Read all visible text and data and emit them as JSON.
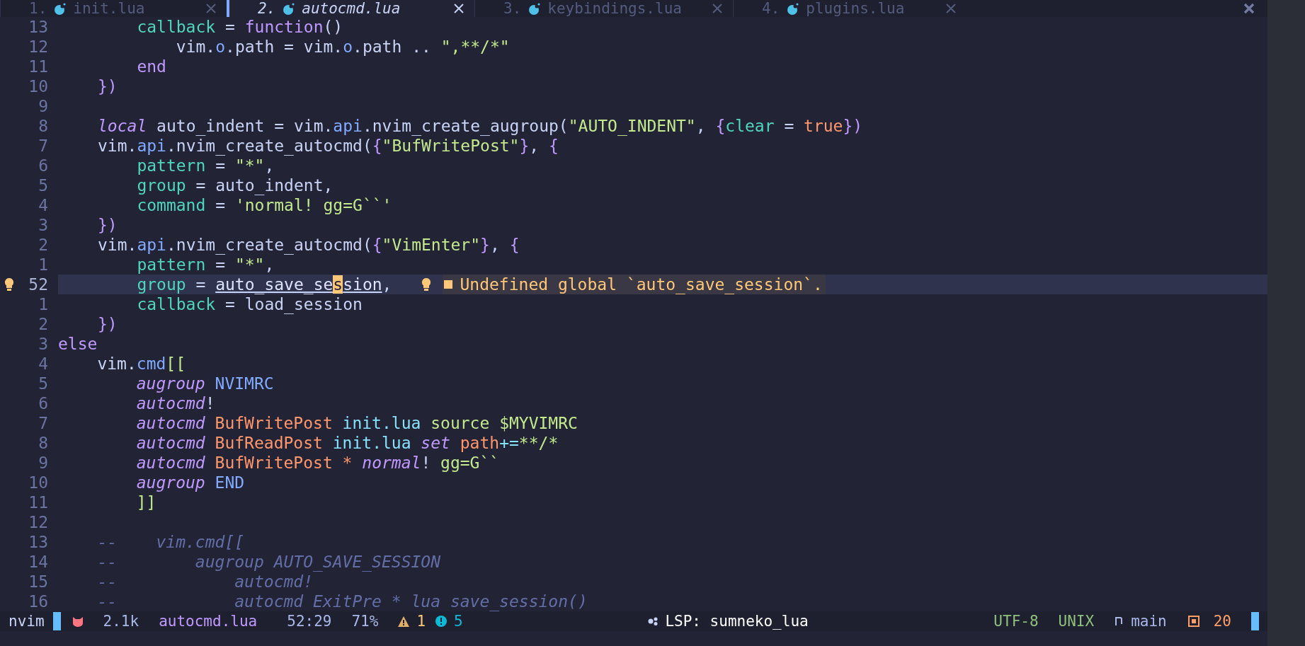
{
  "tabs": [
    {
      "index": "1.",
      "name": "init.lua",
      "selected": false
    },
    {
      "index": "2.",
      "name": "autocmd.lua",
      "selected": true
    },
    {
      "index": "3.",
      "name": "keybindings.lua",
      "selected": false
    },
    {
      "index": "4.",
      "name": "plugins.lua",
      "selected": false
    }
  ],
  "lines": [
    {
      "number": "13",
      "current": false,
      "segments": [
        {
          "text": "    callback",
          "kind": "field"
        },
        {
          "text": " = ",
          "kind": "plain"
        },
        {
          "text": "function",
          "kind": "keyword"
        },
        {
          "text": "()",
          "kind": "plain"
        }
      ]
    },
    {
      "number": "12",
      "current": false,
      "segments": [
        {
          "text": "        vim.",
          "kind": "plain"
        },
        {
          "text": "o",
          "kind": "prop"
        },
        {
          "text": ".path = vim.",
          "kind": "plain"
        },
        {
          "text": "o",
          "kind": "prop"
        },
        {
          "text": ".path .. ",
          "kind": "plain"
        },
        {
          "text": "\",**/*\"",
          "kind": "string"
        }
      ]
    },
    {
      "number": "11",
      "current": false,
      "segments": [
        {
          "text": "    end",
          "kind": "keyword"
        }
      ]
    },
    {
      "number": "10",
      "current": false,
      "segments": [
        {
          "text": "})",
          "kind": "keyword"
        }
      ]
    },
    {
      "number": "9",
      "current": false
    },
    {
      "number": "8",
      "current": false,
      "segments": [
        {
          "text": "local",
          "kind": "keyword-italic"
        },
        {
          "text": " auto_indent = vim.",
          "kind": "plain"
        },
        {
          "text": "api",
          "kind": "prop"
        },
        {
          "text": ".nvim_create_augroup(",
          "kind": "plain"
        },
        {
          "text": "\"AUTO_INDENT\"",
          "kind": "string"
        },
        {
          "text": ", ",
          "kind": "plain"
        },
        {
          "text": "{",
          "kind": "keyword"
        },
        {
          "text": "clear",
          "kind": "field"
        },
        {
          "text": " = ",
          "kind": "plain"
        },
        {
          "text": "true",
          "kind": "constant"
        },
        {
          "text": "})",
          "kind": "keyword"
        }
      ]
    },
    {
      "number": "7",
      "current": false,
      "segments": [
        {
          "text": "vim.",
          "kind": "plain"
        },
        {
          "text": "api",
          "kind": "prop"
        },
        {
          "text": ".nvim_create_autocmd(",
          "kind": "plain"
        },
        {
          "text": "{",
          "kind": "keyword"
        },
        {
          "text": "\"BufWritePost\"",
          "kind": "string"
        },
        {
          "text": "}",
          "kind": "keyword"
        },
        {
          "text": ", ",
          "kind": "plain"
        },
        {
          "text": "{",
          "kind": "keyword"
        }
      ]
    },
    {
      "number": "6",
      "current": false,
      "segments": [
        {
          "text": "    pattern",
          "kind": "field"
        },
        {
          "text": " = ",
          "kind": "plain"
        },
        {
          "text": "\"*\"",
          "kind": "string"
        },
        {
          "text": ",",
          "kind": "plain"
        }
      ]
    },
    {
      "number": "5",
      "current": false,
      "segments": [
        {
          "text": "    group",
          "kind": "field"
        },
        {
          "text": " = auto_indent,",
          "kind": "plain"
        }
      ]
    },
    {
      "number": "4",
      "current": false,
      "segments": [
        {
          "text": "    command",
          "kind": "field"
        },
        {
          "text": " = ",
          "kind": "plain"
        },
        {
          "text": "'normal! gg=G``'",
          "kind": "string"
        }
      ]
    },
    {
      "number": "3",
      "current": false,
      "segments": [
        {
          "text": "})",
          "kind": "keyword"
        }
      ]
    },
    {
      "number": "2",
      "current": false,
      "segments": [
        {
          "text": "vim.",
          "kind": "plain"
        },
        {
          "text": "api",
          "kind": "prop"
        },
        {
          "text": ".nvim_create_autocmd(",
          "kind": "plain"
        },
        {
          "text": "{",
          "kind": "keyword"
        },
        {
          "text": "\"VimEnter\"",
          "kind": "string"
        },
        {
          "text": "}",
          "kind": "keyword"
        },
        {
          "text": ", ",
          "kind": "plain"
        },
        {
          "text": "{",
          "kind": "keyword"
        }
      ]
    },
    {
      "number": "1",
      "current": false,
      "segments": [
        {
          "text": "    pattern",
          "kind": "field"
        },
        {
          "text": " = ",
          "kind": "plain"
        },
        {
          "text": "\"*\"",
          "kind": "string"
        },
        {
          "text": ",",
          "kind": "plain"
        }
      ]
    },
    {
      "number": "52",
      "current": true,
      "segments": [
        {
          "text": "    group",
          "kind": "field"
        },
        {
          "text": " = ",
          "kind": "plain"
        },
        {
          "text": "auto_save_se",
          "kind": "undefined"
        },
        {
          "text": "s",
          "kind": "cursor"
        },
        {
          "text": "sion",
          "kind": "undefined"
        },
        {
          "text": ",",
          "kind": "plain"
        }
      ],
      "diagnostic": "Undefined global `auto_save_session`."
    },
    {
      "number": "1",
      "current": false,
      "segments": [
        {
          "text": "    callback",
          "kind": "field"
        },
        {
          "text": " = load_session",
          "kind": "plain"
        }
      ]
    },
    {
      "number": "2",
      "current": false,
      "segments": [
        {
          "text": "})",
          "kind": "keyword"
        }
      ]
    },
    {
      "number": "3",
      "current": false,
      "outdent": true,
      "segments": [
        {
          "text": "else",
          "kind": "keyword"
        }
      ]
    },
    {
      "number": "4",
      "current": false,
      "outdent": true,
      "segments": [
        {
          "text": "    vim.",
          "kind": "plain"
        },
        {
          "text": "cmd",
          "kind": "prop"
        },
        {
          "text": "[[",
          "kind": "string"
        }
      ]
    },
    {
      "number": "5",
      "current": false,
      "outdent": true,
      "segments": [
        {
          "text": "        augroup",
          "kind": "keyword-italic"
        },
        {
          "text": " NVIMRC",
          "kind": "word"
        }
      ]
    },
    {
      "number": "6",
      "current": false,
      "outdent": true,
      "segments": [
        {
          "text": "        autocmd",
          "kind": "keyword-italic"
        },
        {
          "text": "!",
          "kind": "plain"
        }
      ]
    },
    {
      "number": "7",
      "current": false,
      "outdent": true,
      "segments": [
        {
          "text": "        autocmd",
          "kind": "keyword-italic"
        },
        {
          "text": " BufWritePost",
          "kind": "constant"
        },
        {
          "text": " init.lua",
          "kind": "operator"
        },
        {
          "text": " source $MYVIMRC",
          "kind": "string"
        }
      ]
    },
    {
      "number": "8",
      "current": false,
      "outdent": true,
      "segments": [
        {
          "text": "        autocmd",
          "kind": "keyword-italic"
        },
        {
          "text": " BufReadPost",
          "kind": "constant"
        },
        {
          "text": " init.lua",
          "kind": "operator"
        },
        {
          "text": " set",
          "kind": "keyword-italic"
        },
        {
          "text": " path",
          "kind": "constant"
        },
        {
          "text": "+=",
          "kind": "operator"
        },
        {
          "text": "**/*",
          "kind": "string"
        }
      ]
    },
    {
      "number": "9",
      "current": false,
      "outdent": true,
      "segments": [
        {
          "text": "        autocmd",
          "kind": "keyword-italic"
        },
        {
          "text": " BufWritePost",
          "kind": "constant"
        },
        {
          "text": " *",
          "kind": "constant"
        },
        {
          "text": " normal",
          "kind": "keyword-italic"
        },
        {
          "text": "!",
          "kind": "plain"
        },
        {
          "text": " gg=G``",
          "kind": "string"
        }
      ]
    },
    {
      "number": "10",
      "current": false,
      "outdent": true,
      "segments": [
        {
          "text": "        augroup",
          "kind": "keyword-italic"
        },
        {
          "text": " END",
          "kind": "word"
        }
      ]
    },
    {
      "number": "11",
      "current": false,
      "outdent": true,
      "segments": [
        {
          "text": "        ]]",
          "kind": "string"
        }
      ]
    },
    {
      "number": "12",
      "current": false
    },
    {
      "number": "13",
      "current": false,
      "outdent": true,
      "segments": [
        {
          "text": "    --    vim.cmd[[",
          "kind": "comment"
        }
      ]
    },
    {
      "number": "14",
      "current": false,
      "outdent": true,
      "segments": [
        {
          "text": "    --        augroup AUTO_SAVE_SESSION",
          "kind": "comment"
        }
      ]
    },
    {
      "number": "15",
      "current": false,
      "outdent": true,
      "segments": [
        {
          "text": "    --            autocmd!",
          "kind": "comment"
        }
      ]
    },
    {
      "number": "16",
      "current": false,
      "outdent": true,
      "segments": [
        {
          "text": "    --            autocmd ExitPre * lua save_session()",
          "kind": "comment"
        }
      ]
    }
  ],
  "status_bar": {
    "mode": "nvim",
    "size": "2.1k",
    "file": "autocmd.lua",
    "position": "52:29",
    "percent": "71%",
    "warnings": "1",
    "infos": "5",
    "lsp": "LSP: sumneko_lua",
    "encoding": "UTF-8",
    "format": "UNIX",
    "branch": "main",
    "count": "20"
  }
}
